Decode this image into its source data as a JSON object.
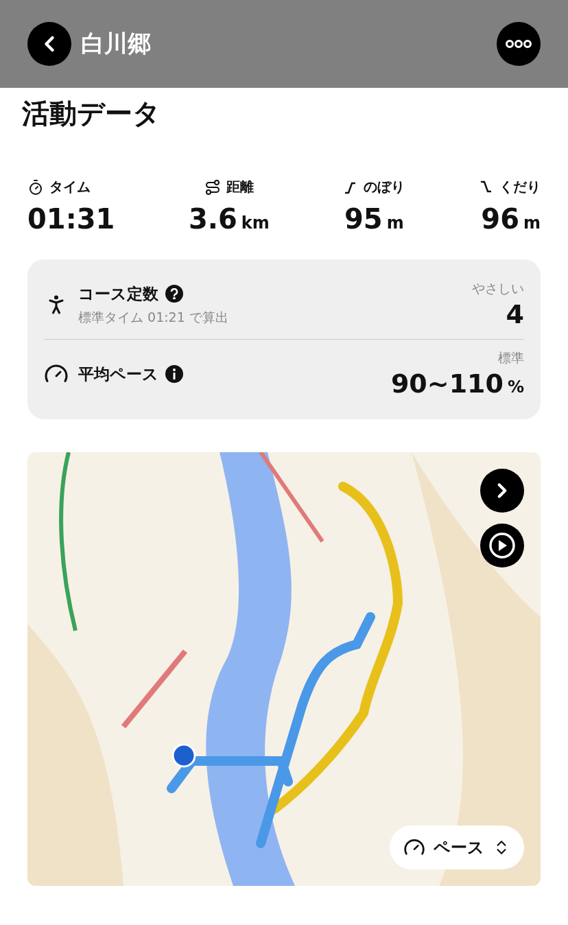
{
  "header": {
    "title": "白川郷"
  },
  "section_title": "活動データ",
  "stats": [
    {
      "kind": "time",
      "label": "タイム",
      "value": "01:31"
    },
    {
      "kind": "distance",
      "label": "距離",
      "value": "3.6",
      "unit": "km"
    },
    {
      "kind": "up",
      "label": "のぼり",
      "value": "95",
      "unit": "m"
    },
    {
      "kind": "down",
      "label": "くだり",
      "value": "96",
      "unit": "m"
    }
  ],
  "summary": [
    {
      "kind": "course",
      "label": "コース定数",
      "note": "標準タイム 01:21 で算出",
      "rating": "やさしい",
      "value": "4"
    },
    {
      "kind": "pace",
      "label": "平均ペース",
      "rating": "標準",
      "value": "90~110",
      "unit": "%"
    }
  ],
  "map": {
    "kind": "picture",
    "selector": "ペース"
  }
}
